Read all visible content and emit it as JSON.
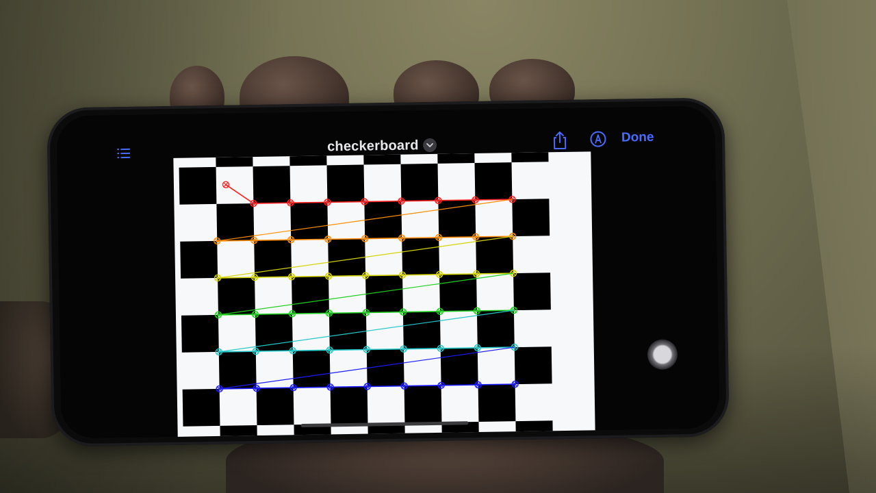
{
  "toolbar": {
    "title": "checkerboard",
    "done_label": "Done",
    "list_icon": "list-icon",
    "chevron_icon": "chevron-down-icon",
    "share_icon": "share-icon",
    "markup_icon": "markup-pen-icon",
    "accent_color": "#4a6bff"
  },
  "document": {
    "description_type": "checkerboard calibration pattern",
    "square_colors": [
      "#000000",
      "#ffffff"
    ],
    "corner_rows": 6,
    "corner_cols": 9,
    "row_colors": [
      "#ff2020",
      "#ff8c00",
      "#d4d400",
      "#20d020",
      "#20c8c8",
      "#1a1aff"
    ]
  },
  "overlay": {
    "assistive_touch_icon": "assistive-touch-icon"
  }
}
